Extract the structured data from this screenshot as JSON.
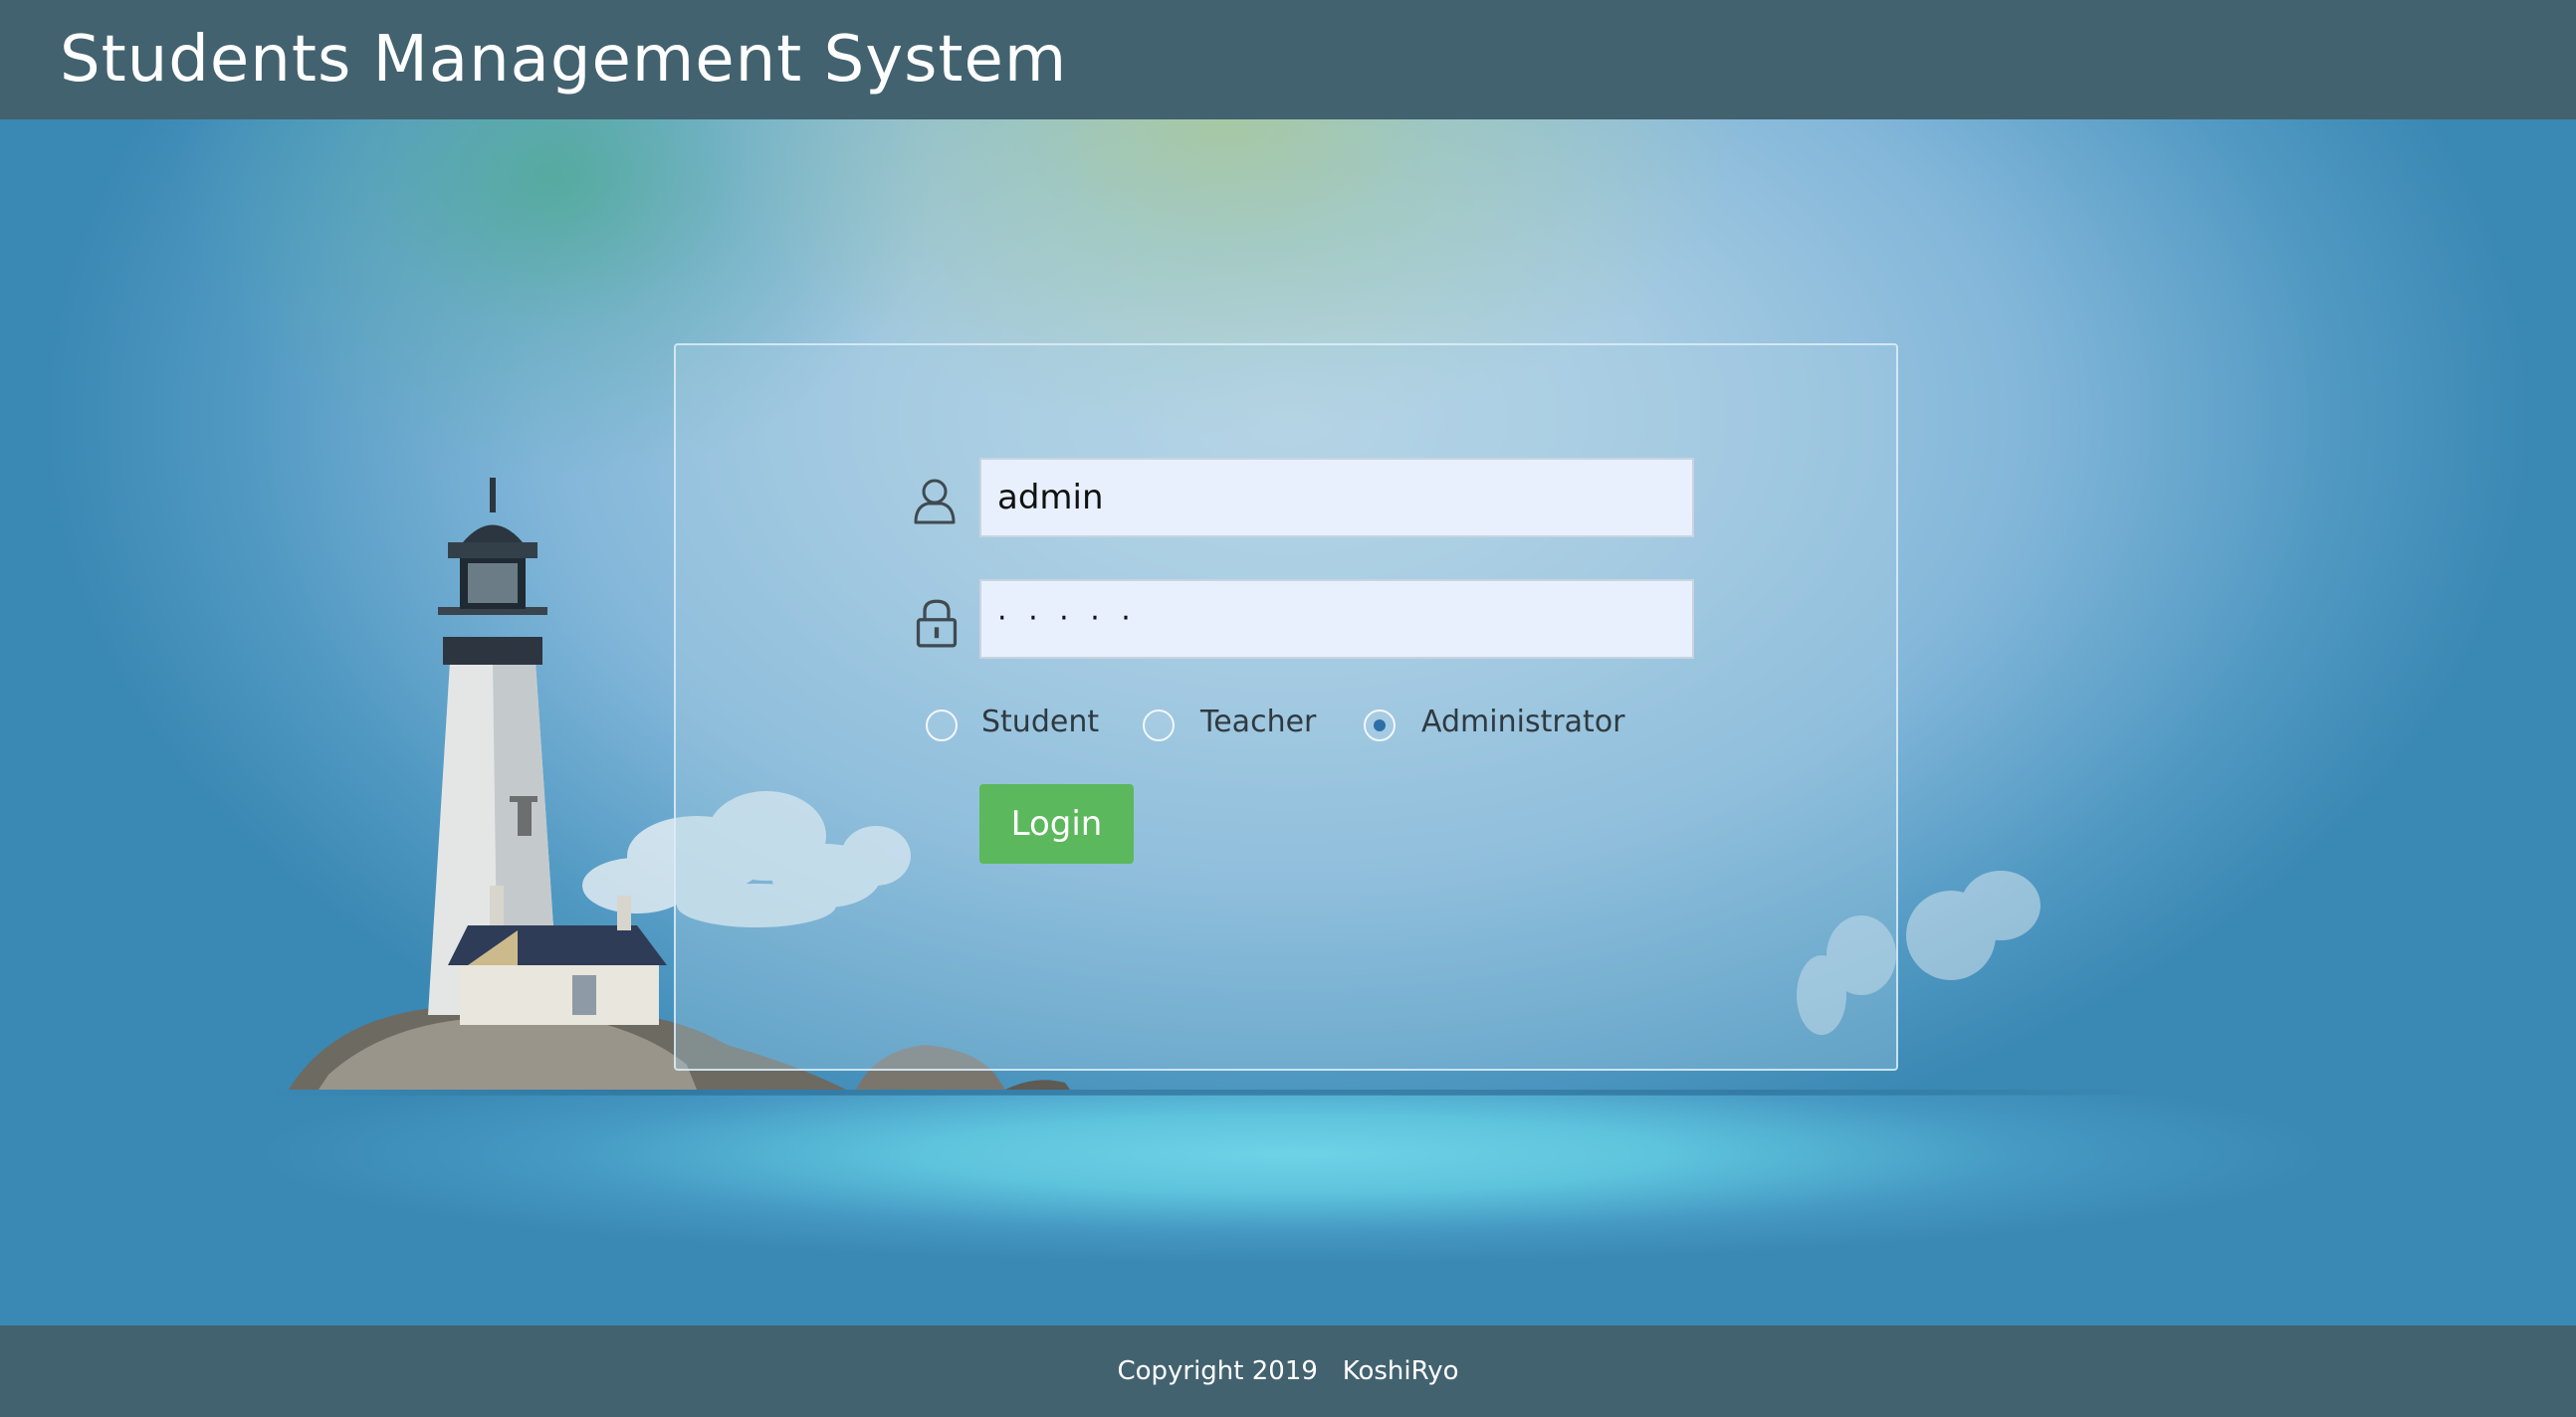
{
  "header": {
    "title": "Students Management System"
  },
  "login": {
    "username_value": "admin",
    "password_mask": "· · · · ·",
    "roles": [
      {
        "label": "Student",
        "checked": false
      },
      {
        "label": "Teacher",
        "checked": false
      },
      {
        "label": "Administrator",
        "checked": true
      }
    ],
    "button_label": "Login",
    "icons": {
      "username": "user-icon",
      "password": "lock-icon"
    }
  },
  "footer": {
    "copyright": "Copyright 2019   KoshiRyo"
  },
  "colors": {
    "header_bg": "#42626f",
    "footer_bg": "#42626f",
    "button_bg": "#5cb85c",
    "input_bg": "#e8f0fe",
    "radio_checked": "#2f6fa8"
  }
}
